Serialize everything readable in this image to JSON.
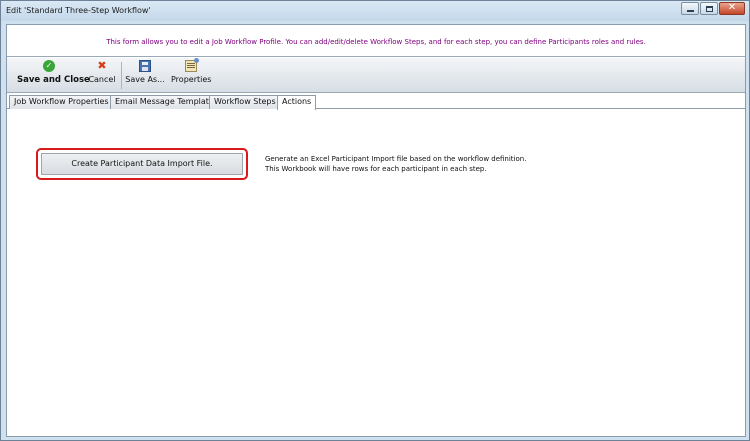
{
  "window": {
    "title": "Edit 'Standard Three-Step Workflow'",
    "controls": {
      "minimize": "minimize",
      "maximize": "maximize",
      "close": "✕"
    }
  },
  "info_text": "This form allows you to edit a Job Workflow Profile. You can add/edit/delete Workflow Steps, and for each step, you can define Participants roles and rules.",
  "toolbar": {
    "save_close_label": "Save and Close",
    "cancel_label": "Cancel",
    "save_as_label": "Save As...",
    "properties_label": "Properties",
    "icons": {
      "save_close": "check-circle-icon",
      "cancel": "cancel-x-icon",
      "save_as": "floppy-disk-icon",
      "properties": "properties-icon"
    }
  },
  "tabs": [
    {
      "label": "Job Workflow Properties",
      "active": false
    },
    {
      "label": "Email Message Template",
      "active": false
    },
    {
      "label": "Workflow Steps",
      "active": false
    },
    {
      "label": "Actions",
      "active": true
    }
  ],
  "actions": {
    "create_import_button": "Create Participant Data Import File.",
    "description_line1": "Generate an Excel Participant Import file based on the workflow definition.",
    "description_line2": "This Workbook will have rows for each participant in each step."
  },
  "colors": {
    "info_text": "#800080",
    "highlight": "#d91a1a"
  }
}
